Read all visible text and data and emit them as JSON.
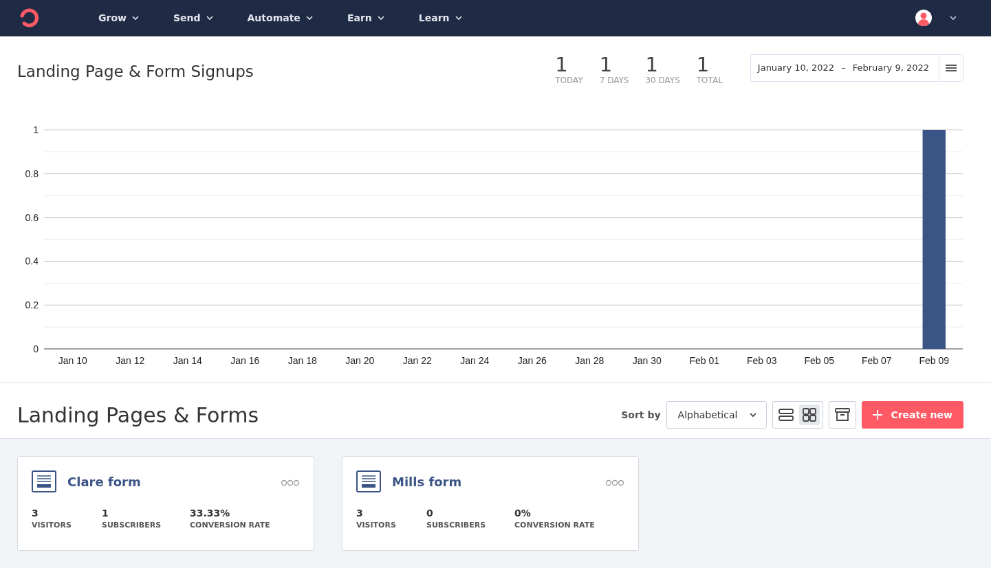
{
  "nav": {
    "items": [
      {
        "label": "Grow"
      },
      {
        "label": "Send"
      },
      {
        "label": "Automate"
      },
      {
        "label": "Earn"
      },
      {
        "label": "Learn"
      }
    ]
  },
  "signups": {
    "title": "Landing Page & Form Signups",
    "stats": [
      {
        "value": "1",
        "label": "TODAY"
      },
      {
        "value": "1",
        "label": "7 DAYS"
      },
      {
        "value": "1",
        "label": "30 DAYS"
      },
      {
        "value": "1",
        "label": "TOTAL"
      }
    ],
    "date_range": {
      "start": "January 10, 2022",
      "separator": "–",
      "end": "February 9, 2022"
    },
    "chart_data": {
      "type": "bar",
      "categories": [
        "Jan 10",
        "Jan 12",
        "Jan 14",
        "Jan 16",
        "Jan 18",
        "Jan 20",
        "Jan 22",
        "Jan 24",
        "Jan 26",
        "Jan 28",
        "Jan 30",
        "Feb 01",
        "Feb 03",
        "Feb 05",
        "Feb 07",
        "Feb 09"
      ],
      "series": [
        {
          "color": "#3b5486",
          "values": [
            0,
            0,
            0,
            0,
            0,
            0,
            0,
            0,
            0,
            0,
            0,
            0,
            0,
            0,
            0,
            1
          ]
        }
      ],
      "ylim": [
        0,
        1
      ],
      "yticks": [
        0,
        0.2,
        0.4,
        0.6,
        0.8,
        1
      ],
      "grid": true
    }
  },
  "list": {
    "title": "Landing Pages & Forms",
    "sort_label": "Sort by",
    "sort_value": "Alphabetical",
    "views": [
      {
        "kind": "rows",
        "selected": false
      },
      {
        "kind": "grid",
        "selected": true
      }
    ],
    "create_label": "Create new",
    "cards": [
      {
        "name": "Clare form",
        "metrics": [
          {
            "value": "3",
            "label": "VISITORS"
          },
          {
            "value": "1",
            "label": "SUBSCRIBERS"
          },
          {
            "value": "33.33%",
            "label": "CONVERSION RATE"
          }
        ]
      },
      {
        "name": "Mills form",
        "metrics": [
          {
            "value": "3",
            "label": "VISITORS"
          },
          {
            "value": "0",
            "label": "SUBSCRIBERS"
          },
          {
            "value": "0%",
            "label": "CONVERSION RATE"
          }
        ]
      }
    ]
  }
}
